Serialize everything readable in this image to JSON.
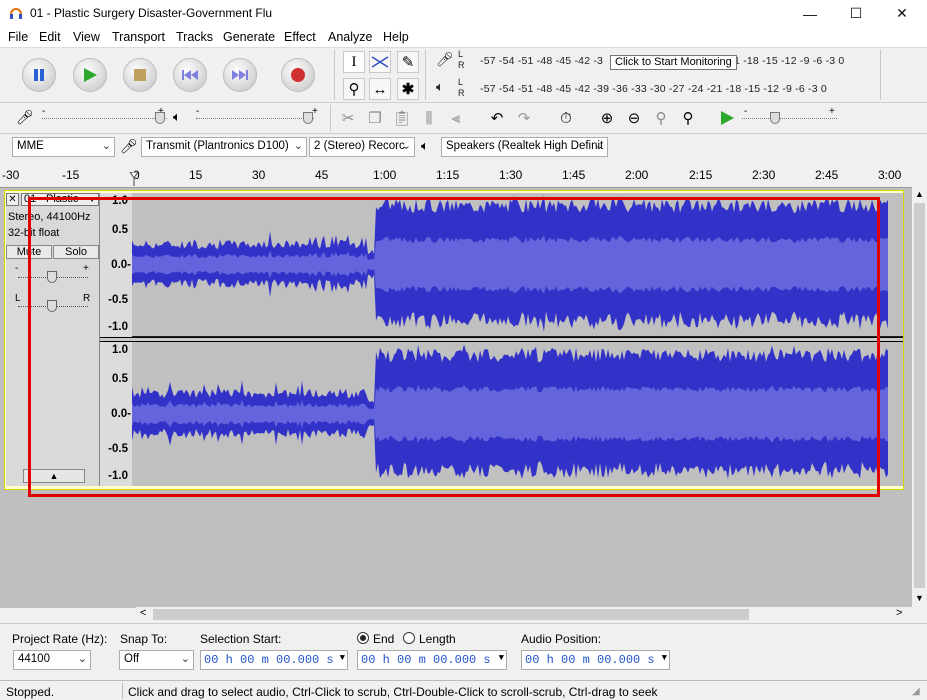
{
  "window": {
    "title": "01 - Plastic Surgery Disaster-Government Flu",
    "minimize": "—",
    "maximize": "☐",
    "close": "✕"
  },
  "menu": [
    "File",
    "Edit",
    "View",
    "Transport",
    "Tracks",
    "Generate",
    "Effect",
    "Analyze",
    "Help"
  ],
  "meters": {
    "record_scale": "-57 -54 -51 -48 -45 -42 -3",
    "record_scale_tail": "21 -18 -15 -12 -9 -6 -3 0",
    "play_scale": "-57 -54 -51 -48 -45 -42 -39 -36 -33 -30 -27 -24 -21 -18 -15 -12 -9 -6 -3 0",
    "tooltip": "Click to Start Monitoring",
    "record_channel_l": "L",
    "record_channel_r": "R",
    "play_channel_l": "L",
    "play_channel_r": "R"
  },
  "mixer": {
    "minus": "-",
    "plus": "+"
  },
  "devices": {
    "host": "MME",
    "recording_device": "Transmit (Plantronics D100)",
    "channels": "2 (Stereo) Recorc",
    "playback_device": "Speakers (Realtek High Definit"
  },
  "ruler": {
    "labels": [
      "-30",
      "-15",
      "0",
      "15",
      "30",
      "45",
      "1:00",
      "1:15",
      "1:30",
      "1:45",
      "2:00",
      "2:15",
      "2:30",
      "2:45",
      "3:00"
    ]
  },
  "track": {
    "name": "01 - Plastic",
    "info_rate": "Stereo, 44100Hz",
    "info_format": "32-bit float",
    "mute": "Mute",
    "solo": "Solo",
    "gain_minus": "-",
    "gain_plus": "+",
    "pan_l": "L",
    "pan_r": "R",
    "close": "✕",
    "collapse": "▲",
    "scale": [
      "1.0",
      "0.5",
      "0.0-",
      "-0.5",
      "-1.0"
    ]
  },
  "bottom": {
    "project_rate_label": "Project Rate (Hz):",
    "project_rate": "44100",
    "snap_label": "Snap To:",
    "snap_value": "Off",
    "selection_start_label": "Selection Start:",
    "end_label": "End",
    "length_label": "Length",
    "selection_start": "00 h 00 m 00.000 s",
    "selection_end": "00 h 00 m 00.000 s",
    "audio_position_label": "Audio Position:",
    "audio_position": "00 h 00 m 00.000 s"
  },
  "status": {
    "state": "Stopped.",
    "hint": "Click and drag to select audio, Ctrl-Click to scrub, Ctrl-Double-Click to scroll-scrub, Ctrl-drag to seek"
  },
  "colors": {
    "waveform": "#3232c8",
    "waveform_rms": "#6464dc",
    "highlight_box": "#e00000",
    "track_selected_bg": "#ffffcc"
  }
}
